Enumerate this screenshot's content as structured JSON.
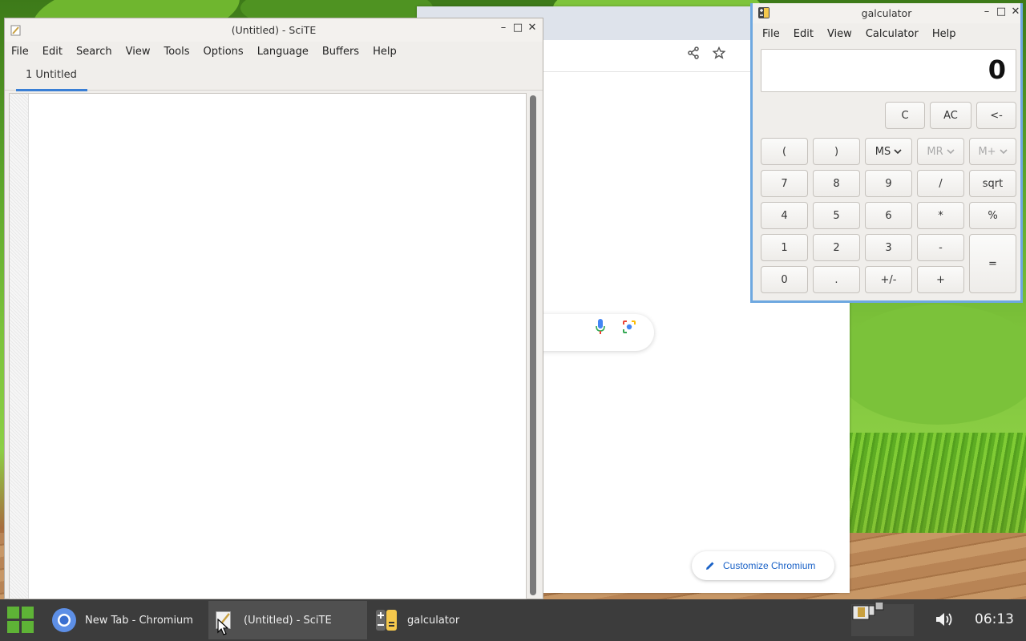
{
  "desktop": {
    "wallpaper": "green-leaves-grass-wooden-deck"
  },
  "chromium": {
    "window_title": "New Tab - Chromium",
    "customize_label": "Customize Chromium",
    "icons": [
      "share-icon",
      "star-icon",
      "mic-icon",
      "lens-icon",
      "pencil-icon"
    ]
  },
  "scite": {
    "title": "(Untitled) - SciTE",
    "menu": [
      "File",
      "Edit",
      "Search",
      "View",
      "Tools",
      "Options",
      "Language",
      "Buffers",
      "Help"
    ],
    "tab_label": "1 Untitled",
    "accent": "#3a7fd5"
  },
  "galculator": {
    "title": "galculator",
    "menu": [
      "File",
      "Edit",
      "View",
      "Calculator",
      "Help"
    ],
    "display_value": "0",
    "top_buttons": [
      "C",
      "AC",
      "<-"
    ],
    "row_paren": [
      "(",
      ")",
      "MS",
      "MR",
      "M+"
    ],
    "row_789": [
      "7",
      "8",
      "9",
      "/",
      "sqrt"
    ],
    "row_456": [
      "4",
      "5",
      "6",
      "*",
      "%"
    ],
    "row_123": [
      "1",
      "2",
      "3",
      "-"
    ],
    "row_0": [
      "0",
      ".",
      "+/-",
      "+"
    ],
    "equals": "=",
    "border_color": "#6ea8e0"
  },
  "taskbar": {
    "tasks": [
      {
        "label": "New Tab - Chromium",
        "icon": "chromium-icon"
      },
      {
        "label": "(Untitled) - SciTE",
        "icon": "scite-icon"
      },
      {
        "label": "galculator",
        "icon": "galculator-icon"
      }
    ],
    "clock": "06:13",
    "color": "#3c3c3c"
  }
}
